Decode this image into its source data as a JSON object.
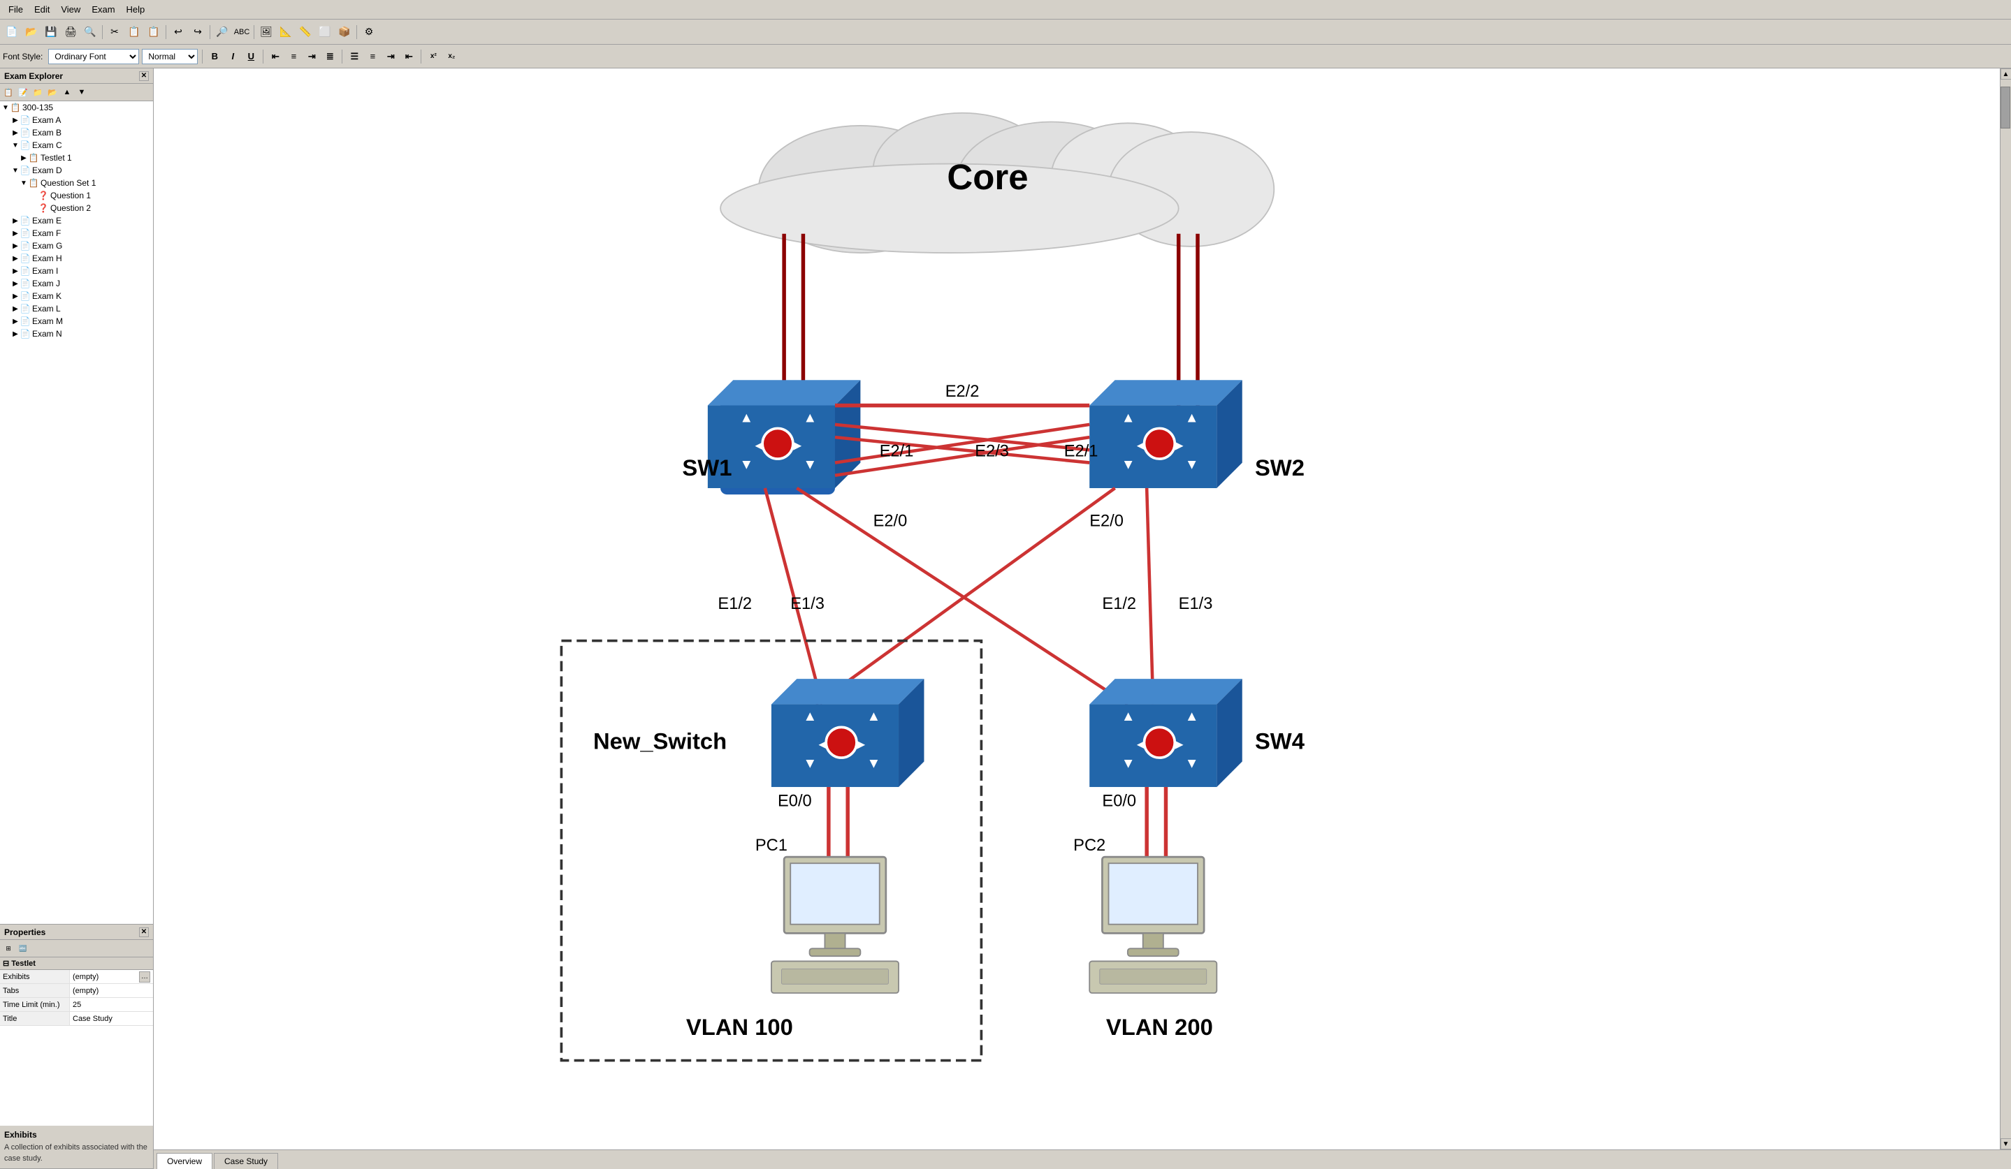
{
  "menu": {
    "items": [
      "File",
      "Edit",
      "View",
      "Exam",
      "Help"
    ]
  },
  "toolbar": {
    "buttons": [
      "📄",
      "📁",
      "💾",
      "🖨",
      "🔍",
      "✂",
      "📋",
      "📋",
      "↩",
      "↪",
      "🔎",
      "🔤",
      "🖼",
      "📐",
      "📏",
      "📦",
      "📦",
      "🔧"
    ]
  },
  "format_bar": {
    "font_style_label": "Font Style:",
    "font_style_value": "Ordinary Font",
    "size_value": "Normal",
    "bold": "B",
    "italic": "I",
    "underline": "U",
    "align_left": "≡",
    "align_center": "≡",
    "align_right": "≡",
    "align_justify": "≡"
  },
  "explorer": {
    "title": "Exam Explorer",
    "root": "300-135",
    "items": [
      {
        "label": "Exam A",
        "level": 1,
        "expanded": false
      },
      {
        "label": "Exam B",
        "level": 1,
        "expanded": false
      },
      {
        "label": "Exam C",
        "level": 1,
        "expanded": true
      },
      {
        "label": "Testlet 1",
        "level": 2,
        "expanded": false
      },
      {
        "label": "Exam D",
        "level": 1,
        "expanded": true
      },
      {
        "label": "Question Set 1",
        "level": 2,
        "expanded": true
      },
      {
        "label": "Question 1",
        "level": 3,
        "expanded": false
      },
      {
        "label": "Question 2",
        "level": 3,
        "expanded": false
      },
      {
        "label": "Exam E",
        "level": 1,
        "expanded": false
      },
      {
        "label": "Exam F",
        "level": 1,
        "expanded": false
      },
      {
        "label": "Exam G",
        "level": 1,
        "expanded": false
      },
      {
        "label": "Exam H",
        "level": 1,
        "expanded": false
      },
      {
        "label": "Exam I",
        "level": 1,
        "expanded": false
      },
      {
        "label": "Exam J",
        "level": 1,
        "expanded": false
      },
      {
        "label": "Exam K",
        "level": 1,
        "expanded": false
      },
      {
        "label": "Exam L",
        "level": 1,
        "expanded": false
      },
      {
        "label": "Exam M",
        "level": 1,
        "expanded": false
      },
      {
        "label": "Exam N",
        "level": 1,
        "expanded": false
      }
    ]
  },
  "properties": {
    "title": "Properties",
    "section": "Testlet",
    "rows": [
      {
        "name": "Exhibits",
        "value": "(empty)",
        "has_button": true
      },
      {
        "name": "Tabs",
        "value": "(empty)",
        "has_button": false
      },
      {
        "name": "Time Limit (min.)",
        "value": "25",
        "has_button": false
      },
      {
        "name": "Title",
        "value": "Case Study",
        "has_button": false
      }
    ]
  },
  "exhibits": {
    "title": "Exhibits",
    "description": "A collection of exhibits associated with the case study."
  },
  "diagram": {
    "core_label": "Core",
    "sw1_label": "SW1",
    "sw2_label": "SW2",
    "new_switch_label": "New_Switch",
    "sw4_label": "SW4",
    "pc1_label": "PC1",
    "pc2_label": "PC2",
    "vlan100_label": "VLAN 100",
    "vlan200_label": "VLAN 200",
    "sw1_e2_2": "E2/2",
    "sw1_e2_1": "E2/1",
    "sw1_e2_3": "E2/3",
    "sw1_e2_0": "E2/0",
    "sw2_e2_1": "E2/1",
    "sw2_e2_0": "E2/0",
    "ns_e1_2": "E1/2",
    "ns_e1_3": "E1/3",
    "sw4_e1_2": "E1/2",
    "sw4_e1_3": "E1/3",
    "ns_e0_0": "E0/0",
    "sw4_e0_0": "E0/0"
  },
  "tabs": {
    "overview_label": "Overview",
    "case_study_label": "Case Study",
    "active": "Overview"
  }
}
